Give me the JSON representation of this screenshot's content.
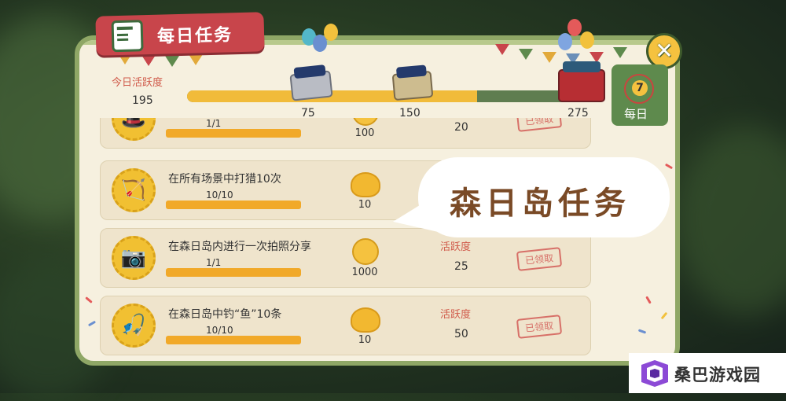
{
  "header": {
    "title": "每日任务"
  },
  "activity": {
    "label": "今日活跃度",
    "value": "195",
    "progress": 195,
    "max": 275,
    "milestones": [
      {
        "label": "75",
        "value": 75
      },
      {
        "label": "150",
        "value": 150
      },
      {
        "label": "275",
        "value": 275
      }
    ]
  },
  "side_tab": {
    "badge": "7",
    "label": "每日"
  },
  "tasks": [
    {
      "title": "",
      "progress": "1/1",
      "reward_value": "100",
      "activity_tag": "",
      "activity_value": "20",
      "status": "已领取",
      "icon": "hat-icon",
      "reward_icon": "coin-icon"
    },
    {
      "title": "在所有场景中打猎10次",
      "progress": "10/10",
      "reward_value": "10",
      "activity_tag": "",
      "activity_value": "",
      "status": "",
      "icon": "hunt-icon",
      "reward_icon": "shell-icon"
    },
    {
      "title": "在森日岛内进行一次拍照分享",
      "progress": "1/1",
      "reward_value": "1000",
      "activity_tag": "活跃度",
      "activity_value": "25",
      "status": "已领取",
      "icon": "camera-icon",
      "reward_icon": "coin-icon"
    },
    {
      "title": "在森日岛中钓“鱼”10条",
      "progress": "10/10",
      "reward_value": "10",
      "activity_tag": "活跃度",
      "activity_value": "50",
      "status": "已领取",
      "icon": "fishing-icon",
      "reward_icon": "shell-icon"
    }
  ],
  "bubble": {
    "text": "森日岛任务"
  },
  "watermark": {
    "text": "桑巴游戏园"
  },
  "colors": {
    "accent_red": "#c8454b",
    "progress_yellow": "#f1bb3a",
    "panel_green": "#8fa766"
  }
}
